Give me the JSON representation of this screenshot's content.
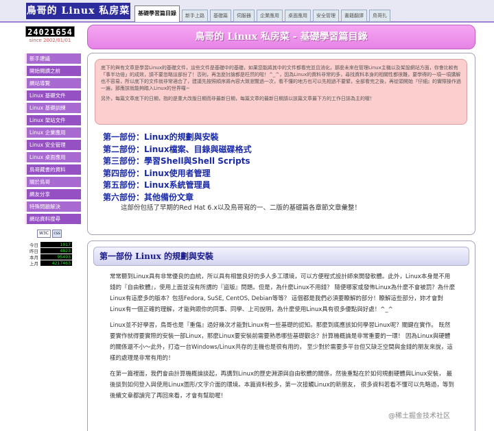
{
  "header": {
    "site_title": "鳥哥的 Linux 私房菜",
    "tabs": [
      {
        "label": "基礎學習篇目錄",
        "active": true
      },
      {
        "label": "新手上路"
      },
      {
        "label": "基礎篇"
      },
      {
        "label": "伺服器"
      },
      {
        "label": "企業應用"
      },
      {
        "label": "桌面應用"
      },
      {
        "label": "安全管理"
      },
      {
        "label": "書籍翻譯"
      },
      {
        "label": "鳥哥扎"
      }
    ]
  },
  "sidebar": {
    "counter": "24021654",
    "since": "since 2002/01/01",
    "nav_items": [
      "新手建議",
      "開始閱讀之前",
      "網站導覽",
      "Linux 基礎文件",
      "Linux 基礎訓練",
      "Linux 架站文件",
      "Linux 企業應用",
      "Linux 安全管理",
      "Linux 桌面應用",
      "鳥哥藏書的資料",
      "關於鳥哥",
      "網友分享",
      "特殊問題解決",
      "網站資料搜尋"
    ],
    "badges": {
      "w3c": "W3C",
      "css": "css"
    },
    "stats": [
      {
        "label": "今日",
        "value": "1017"
      },
      {
        "label": "昨日",
        "value": "4823"
      },
      {
        "label": "本月",
        "value": "95493"
      },
      {
        "label": "上月",
        "value": "4217463"
      }
    ]
  },
  "main": {
    "page_title": "鳥哥的 Linux 私房菜 - 基礎學習篇目錄",
    "intro_p1": "底下的與有文章是學習Linux的基礎文件，這些文件是基礎中的基礎，如果您能將其中的文件都看完並且消化，那麼未來在管理Linux主機以及架設網站方面，你會比較有「事半功倍」的成效，請不要忽略這部份了！否則，再怎麼討論都是枉然的啦！^_^，因為Linux的資料非常的多，尋找資料本身的相關性都很難，要學得的一項一項講解也不容易，所以底下的文件就非常適合了，建議先按照順序將內容大致瀏覽過一次，看不懂的地方也可以先相過不要緊，全部看完之後，再從頭開始『仔細』的實際操作過一遍，那應該就能夠踏入Linux的世界囉~",
    "intro_p2": "另外，每篇文章底下的日期，指的是重大改版日期而非最新日期，每篇文章的最新日期請以該篇文章最下方的工作日誌為主的喔！",
    "parts": [
      "第一部份：Linux的規劃與安裝",
      "第二部份：Linux檔案、目錄與磁碟格式",
      "第三部份：學習Shell與Shell Scripts",
      "第四部份：Linux使用者管理",
      "第五部份：Linux系統管理員",
      "第六部份：其他備份文章"
    ],
    "part_note": "這部份包括了早期的Red Hat 6.x以及鳥哥寫的一、二版的基礎篇各章節文章彙整！",
    "section_title": "第一部份 Linux 的規劃與安裝",
    "section_p1": "常常聽到Linux具有非常優良的血統，所以具有相當良好的多人多工環境，可以方便程式設計師來開發軟體。此外，Linux本身是不用錢的『自由軟體』，使用上面並沒有所謂的『盜版』問題。但是，為什麼Linux不用錢？ 隨便哪家或發佈Linux為什麼不會被罰？為什麼Linux有這麼多的版本？包括Fedora, SuSE, CentOS, Debian等等？ 這個都是我們必須要瞭解的部分！瞭解這些部分，妳才會對Linux有一個正確的理解，才能夠跟你的同事、同學、上司說明，為什麼使用Linux具有很多優點與好處！^_^",
    "section_p2": "Linux並不好學習，鳥哥也是『重傷』過好幾次才能對Linux有一些基礎的認知。那麼到底應該如何學習Linux呢？關鍵在實作。 既然要實作就得要實際的安裝一部Linux，那麼Linux要安裝前需要熟悉哪些基礎觀念？計算機概論是非常重要的一環！ 因為Linux與硬體的關係還不小～此外，打造一台Windows/Linux共存的主機也是很有用的， 至少對於需要多平台但又缺乏空間與金錢的朋友來說，這樣的處理是非常有用的！",
    "section_p3": "在第一篇裡面，我們會由計算機概論談起，再講到Linux的歷史淵源與自由軟體的關係，然後重點在於如何規劃硬體與Linux安裝， 最後談到如何登入與使用Linux圖形/文字介面的環境。本篇資料較多，第一次接觸Linux的新朋友， 很多資料若看不懂可以先略過，等到後續文章都讀完了再回來看，才會有幫助喔！"
  },
  "watermark": "@稀土掘金技术社区"
}
